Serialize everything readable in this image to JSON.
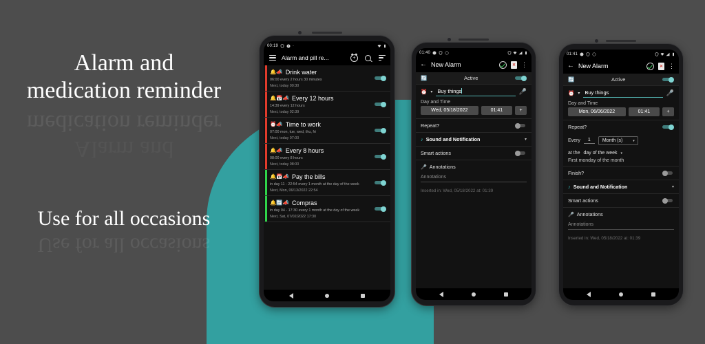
{
  "promo": {
    "line1": "Alarm and",
    "line2": "medication reminder",
    "line3": "Use for all occasions"
  },
  "colors": {
    "background": "#4d4d4d",
    "accent_teal": "#33a0a0",
    "toggle_on": "#7fd4d2",
    "stripe_red": "#e23b2c",
    "stripe_green": "#2fd44a",
    "check_green": "#39c75a",
    "trash_red": "#d23a2e"
  },
  "phone1": {
    "statusbar": {
      "clock": "00:19",
      "icons_left": [
        "shield-icon",
        "clock-icon",
        "dot-icon"
      ],
      "icons_right": [
        "wifi-icon",
        "battery-icon"
      ]
    },
    "appbar": {
      "menu": "menu-icon",
      "title": "Alarm and pill re...",
      "add_alarm": "alarm-add-icon",
      "search": "search-icon",
      "sort": "sort-icon"
    },
    "alarms": [
      {
        "emojis": "🔔📣",
        "title": "Drink water",
        "sub": "06:00  every 2 hours 30 minutes",
        "next": "Next, today 00:30",
        "stripe": "#e23b2c",
        "enabled": true
      },
      {
        "emojis": "🔔📅📣",
        "title": "Every 12 hours",
        "sub": "14:39  every 12 hours",
        "next": "Next, today 02:39",
        "stripe": "#e23b2c",
        "enabled": true
      },
      {
        "emojis": "⏰📣",
        "title": "Time to work",
        "sub": "07:00  mon, tue, wed, thu, fri",
        "next": "Next, today 07:00",
        "stripe": "#e23b2c",
        "enabled": true
      },
      {
        "emojis": "🔔📣",
        "title": "Every 8 hours",
        "sub": "08:00  every 8 hours",
        "next": "Next, today 08:00",
        "stripe": "#e23b2c",
        "enabled": true
      },
      {
        "emojis": "🔔📅📣",
        "title": "Pay the bills",
        "sub": "in day 11 - 22:54  every 1 month at the day of the week",
        "next": "Next, Mon, 06/13/2022 22:54",
        "stripe": "#2fd44a",
        "enabled": true
      },
      {
        "emojis": "🔔🔄📣",
        "title": "Compras",
        "sub": "in day 04 - 17:30  every 1 month at the day of the week",
        "next": "Next, Sat, 07/02/2022 17:30",
        "stripe": "#2fd44a",
        "enabled": true
      }
    ],
    "navbar": {
      "back": "back-nav-icon",
      "home": "home-nav-icon",
      "recents": "recents-nav-icon"
    }
  },
  "phone2": {
    "statusbar": {
      "clock": "01:40",
      "icons_right": [
        "shield-icon",
        "wifi-icon",
        "signal-icon",
        "battery-icon"
      ]
    },
    "appbar": {
      "back": "back-arrow-icon",
      "title": "New Alarm",
      "save": "save-check-icon",
      "delete": "delete-icon",
      "overflow": "overflow-menu-icon"
    },
    "active_label": "Active",
    "active_on": true,
    "type_icon": "alarm-clock-icon",
    "name_value": "Buy things",
    "mic": "microphone-icon",
    "day_time_label": "Day and Time",
    "date_value": "Wed, 05/18/2022",
    "time_value": "01:41",
    "add_more": "+",
    "repeat_label": "Repeat?",
    "repeat_on": false,
    "sound_label": "Sound and Notification",
    "smart_actions_label": "Smart actions",
    "smart_actions_on": false,
    "annotations_label": "Annotations",
    "annotations_placeholder": "Annotations",
    "inserted": "Inserted in: Wed, 05/18/2022 at: 01:39",
    "navbar": {
      "back": "back-nav-icon",
      "home": "home-nav-icon",
      "recents": "recents-nav-icon"
    }
  },
  "phone3": {
    "statusbar": {
      "clock": "01:41",
      "icons_right": [
        "shield-icon",
        "wifi-icon",
        "signal-icon",
        "battery-icon"
      ]
    },
    "appbar": {
      "back": "back-arrow-icon",
      "title": "New Alarm",
      "save": "save-check-icon",
      "delete": "delete-icon",
      "overflow": "overflow-menu-icon"
    },
    "active_label": "Active",
    "active_on": true,
    "name_value": "Buy things",
    "day_time_label": "Day and Time",
    "date_value": "Mon, 06/06/2022",
    "time_value": "01:41",
    "add_more": "+",
    "repeat_label": "Repeat?",
    "repeat_on": true,
    "every_label": "Every",
    "every_value": "1",
    "period_value": "Month (s)",
    "at_the_label": "at the",
    "mode_value": "day of the week",
    "rule_desc": "First monday of the month",
    "finish_label": "Finish?",
    "finish_on": false,
    "sound_label": "Sound and Notification",
    "smart_actions_label": "Smart actions",
    "smart_actions_on": false,
    "annotations_label": "Annotations",
    "annotations_placeholder": "Annotations",
    "inserted": "Inserted in: Wed, 05/18/2022 at: 01:39",
    "navbar": {
      "back": "back-nav-icon",
      "home": "home-nav-icon",
      "recents": "recents-nav-icon"
    }
  }
}
